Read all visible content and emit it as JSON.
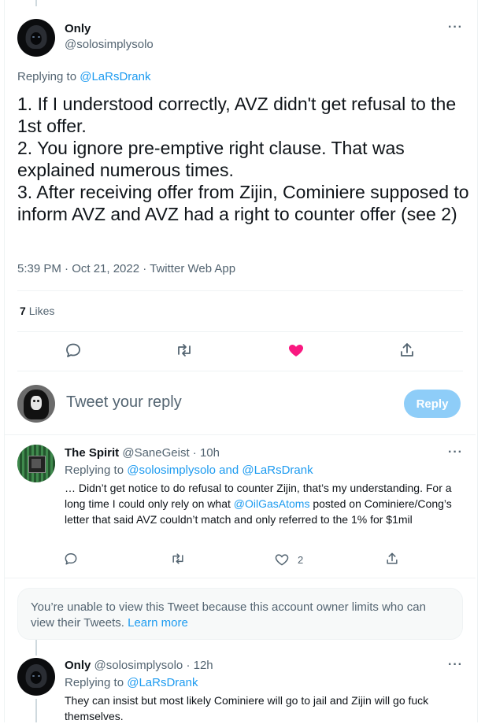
{
  "main_tweet": {
    "name": "Only",
    "handle": "@solosimplysolo",
    "replying_prefix": "Replying to ",
    "replying_to": "@LaRsDrank",
    "lines": [
      "1. If I understood correctly, AVZ didn't get refusal to the 1st offer.",
      "2. You ignore pre-emptive right clause. That was explained numerous times.",
      "3. After receiving offer from Zijin, Cominiere supposed to inform AVZ and AVZ had a right to counter offer (see 2)"
    ],
    "timestamp": "5:39 PM · Oct 21, 2022 · Twitter Web App",
    "likes_count": "7",
    "likes_label": "Likes",
    "liked_color": "#f91880"
  },
  "composer": {
    "placeholder": "Tweet your reply",
    "reply_label": "Reply"
  },
  "reply1": {
    "name": "The Spirit",
    "handle": "@SaneGeist",
    "time": "· 10h",
    "replying_prefix": "Replying to ",
    "replying_to_1": "@solosimplysolo",
    "replying_and": " and ",
    "replying_to_2": "@LaRsDrank",
    "text_part1": "… Didn’t get notice to do refusal to counter Zijin, that’s my understanding. For a long time I could only rely on what ",
    "mention": "@OilGasAtoms",
    "text_part2": " posted on Cominiere/Cong’s letter that said AVZ couldn’t match and only referred to the 1% for $1mil",
    "like_count": "2"
  },
  "limited_notice": {
    "text": "You’re unable to view this Tweet because this account owner limits who can view their Tweets. ",
    "link": "Learn more"
  },
  "reply2": {
    "name": "Only",
    "handle": "@solosimplysolo",
    "time": "· 12h",
    "replying_prefix": "Replying to ",
    "replying_to": "@LaRsDrank",
    "text": "They can insist but most likely Cominiere will go to jail and Zijin will go fuck themselves."
  },
  "colors": {
    "accent": "#1d9bf0",
    "muted": "#536471",
    "like": "#f91880"
  },
  "icons": [
    "more-icon",
    "reply-icon",
    "retweet-icon",
    "heart-icon",
    "share-icon"
  ]
}
